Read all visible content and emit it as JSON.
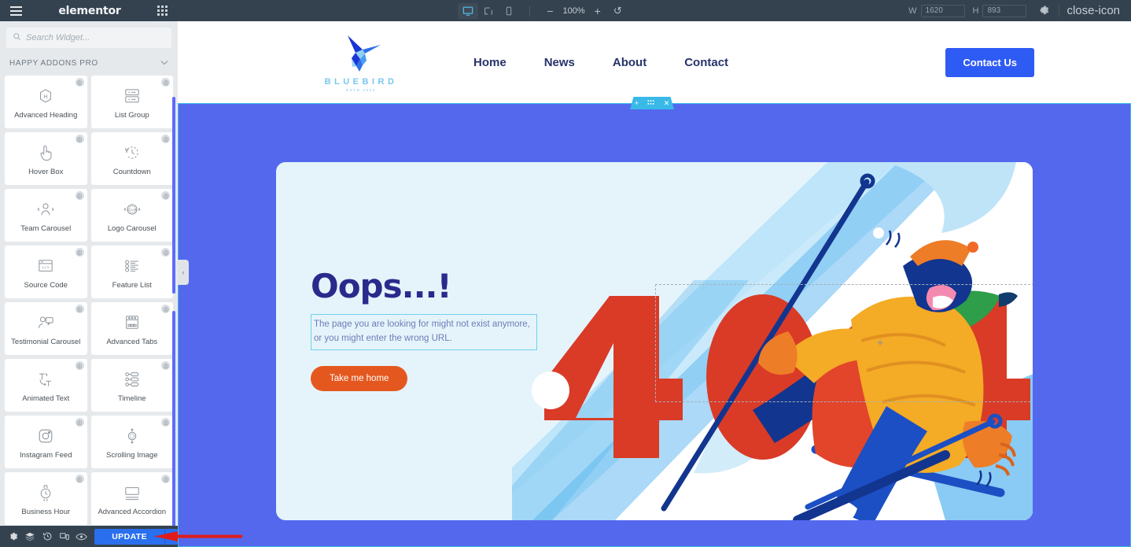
{
  "topbar": {
    "menu_icon": "hamburger-icon",
    "brand": "elementor",
    "apps_icon": "grid-apps-icon",
    "devices": [
      {
        "name": "desktop",
        "label": "Desktop",
        "active": true
      },
      {
        "name": "tablet",
        "label": "Tablet",
        "active": false
      },
      {
        "name": "mobile",
        "label": "Mobile",
        "active": false
      }
    ],
    "zoom_out": "−",
    "zoom_level": "100%",
    "zoom_in": "+",
    "zoom_reset": "↺",
    "width_label": "W",
    "width_value": "1620",
    "height_label": "H",
    "height_value": "893",
    "settings_icon": "gear-icon",
    "close_icon": "close-icon"
  },
  "panel": {
    "search": {
      "placeholder": "Search Widget...",
      "value": "",
      "icon": "search-icon"
    },
    "category": {
      "title": "HAPPY ADDONS PRO",
      "chevron": "∨"
    },
    "widgets": [
      {
        "label": "Advanced Heading",
        "icon": "advanced-heading-icon",
        "pro": true
      },
      {
        "label": "List Group",
        "icon": "list-group-icon",
        "pro": true
      },
      {
        "label": "Hover Box",
        "icon": "hover-box-icon",
        "pro": true
      },
      {
        "label": "Countdown",
        "icon": "countdown-icon",
        "pro": true
      },
      {
        "label": "Team Carousel",
        "icon": "team-carousel-icon",
        "pro": true
      },
      {
        "label": "Logo Carousel",
        "icon": "logo-carousel-icon",
        "pro": true
      },
      {
        "label": "Source Code",
        "icon": "source-code-icon",
        "pro": true
      },
      {
        "label": "Feature List",
        "icon": "feature-list-icon",
        "pro": true
      },
      {
        "label": "Testimonial Carousel",
        "icon": "testimonial-carousel-icon",
        "pro": true
      },
      {
        "label": "Advanced Tabs",
        "icon": "advanced-tabs-icon",
        "pro": true
      },
      {
        "label": "Animated Text",
        "icon": "animated-text-icon",
        "pro": true
      },
      {
        "label": "Timeline",
        "icon": "timeline-icon",
        "pro": true
      },
      {
        "label": "Instagram Feed",
        "icon": "instagram-feed-icon",
        "pro": true
      },
      {
        "label": "Scrolling Image",
        "icon": "scrolling-image-icon",
        "pro": true
      },
      {
        "label": "Business Hour",
        "icon": "business-hour-icon",
        "pro": true
      },
      {
        "label": "Advanced Accordion",
        "icon": "advanced-accordion-icon",
        "pro": true
      }
    ],
    "collapse_chevron": "‹"
  },
  "bottombar": {
    "tools": [
      {
        "name": "settings-icon",
        "label": "Settings"
      },
      {
        "name": "navigator-icon",
        "label": "Navigator"
      },
      {
        "name": "history-icon",
        "label": "History"
      },
      {
        "name": "responsive-mode-icon",
        "label": "Responsive Mode"
      },
      {
        "name": "preview-icon",
        "label": "Preview Changes"
      }
    ],
    "update_label": "UPDATE",
    "update_caret": "▴"
  },
  "canvas": {
    "site_header": {
      "logo": {
        "name": "BLUEBIRD",
        "tagline": "ESTD 2022"
      },
      "nav": [
        {
          "label": "Home"
        },
        {
          "label": "News"
        },
        {
          "label": "About"
        },
        {
          "label": "Contact"
        }
      ],
      "cta_label": "Contact Us"
    },
    "section_handle": {
      "add": "+",
      "drag": "⋮⋮",
      "remove": "✕"
    },
    "content": {
      "heading": "Oops...!",
      "paragraph": "The page you are looking for might not exist anymore, or you might enter the wrong URL.",
      "button_label": "Take me home",
      "illustration": {
        "name": "skier-404-illustration",
        "error_code": "404",
        "placeholder_plus": "+"
      }
    }
  },
  "colors": {
    "topbar_bg": "#34424f",
    "panel_bg": "#e6e9ec",
    "section_bg": "#5468ee",
    "card_bg": "#e5f4fb",
    "accent_blue": "#2a6fee",
    "cta_blue": "#2f5bf5",
    "heading_navy": "#2a2a8c",
    "button_orange": "#e4581f",
    "error_red": "#d93b27",
    "selection_cyan": "#39b9e8",
    "annotation_red": "#e01b1b"
  }
}
